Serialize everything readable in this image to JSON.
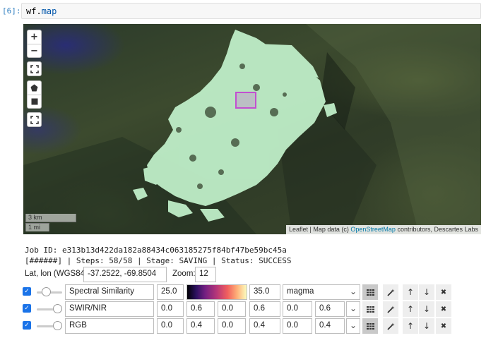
{
  "cell": {
    "prompt": "[6]:",
    "code_obj": "wf",
    "code_attr": "map",
    "code_dot": "."
  },
  "map": {
    "zoom_in": "+",
    "zoom_out": "−",
    "fullscreen_icon": "fullscreen-icon",
    "draw_polygon_icon": "polygon-icon",
    "draw_rectangle_icon": "rectangle-icon",
    "fit_icon": "fit-bounds-icon",
    "scale_km": "3 km",
    "scale_mi": "1 mi",
    "attribution_prefix": "Leaflet | Map data (c) ",
    "attribution_link": "OpenStreetMap",
    "attribution_suffix": " contributors, Descartes Labs",
    "highlight_color": "#c24fd0",
    "overlay_color": "#bfeec8"
  },
  "job": {
    "id_line": "Job ID: e313b13d422da182a88434c063185275f84bf47be59bc45a",
    "status_line": "[######] | Steps: 58/58 | Stage: SAVING | Status: SUCCESS"
  },
  "location": {
    "latlon_label": "Lat, lon (WGS84):",
    "latlon_value": "-37.2522, -69.8504",
    "zoom_label": "Zoom:",
    "zoom_value": "12"
  },
  "layers": [
    {
      "checked": true,
      "opacity": 0.3,
      "name": "Spectral Similarity",
      "min": "25.0",
      "max": "35.0",
      "colormap": "magma",
      "chevron": "⌄"
    },
    {
      "checked": true,
      "opacity": 1.0,
      "name": "SWIR/NIR",
      "scales": [
        "0.0",
        "0.6",
        "0.0",
        "0.6",
        "0.0",
        "0.6"
      ],
      "chevron": "⌄"
    },
    {
      "checked": true,
      "opacity": 1.0,
      "name": "RGB",
      "scales": [
        "0.0",
        "0.4",
        "0.0",
        "0.4",
        "0.0",
        "0.4"
      ],
      "chevron": "⌄"
    }
  ],
  "row_buttons": {
    "grid_icon": "grid-icon",
    "wand_icon": "magic-wand-icon",
    "up_icon": "↑",
    "down_icon": "↓",
    "remove_icon": "✖"
  }
}
